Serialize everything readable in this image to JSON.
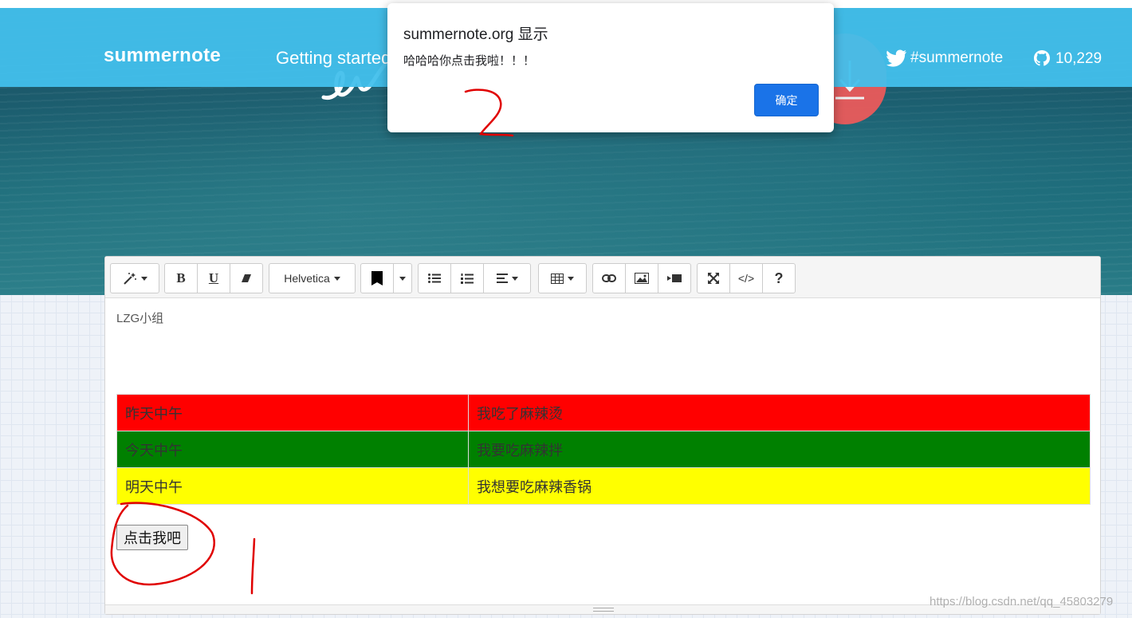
{
  "site": {
    "brand": "summernote",
    "nav_link": "Getting started",
    "twitter_label": "#summernote",
    "github_stars": "10,229"
  },
  "dialog": {
    "title": "summernote.org 显示",
    "message": "哈哈哈你点击我啦！！！",
    "ok_label": "确定"
  },
  "toolbar": {
    "font_name": "Helvetica",
    "bold_label": "B",
    "underline_label": "U",
    "codeview_label": "</>",
    "help_label": "?"
  },
  "content": {
    "group_label": "LZG小组",
    "table_rows": [
      {
        "col1": "昨天中午",
        "col2": "我吃了麻辣烫",
        "bg": "#ff0000"
      },
      {
        "col1": "今天中午",
        "col2": "我要吃麻辣拌",
        "bg": "#008000"
      },
      {
        "col1": "明天中午",
        "col2": "我想要吃麻辣香锅",
        "bg": "#ffff00"
      }
    ],
    "button_label": "点击我吧"
  },
  "annotations": {
    "label_1": "1",
    "label_2": "2"
  },
  "watermark": "https://blog.csdn.net/qq_45803279",
  "colors": {
    "navbar": "#42c0ec",
    "dialog_button": "#1a73e8",
    "download_button": "#f05a5a",
    "annotation": "#e00000"
  }
}
